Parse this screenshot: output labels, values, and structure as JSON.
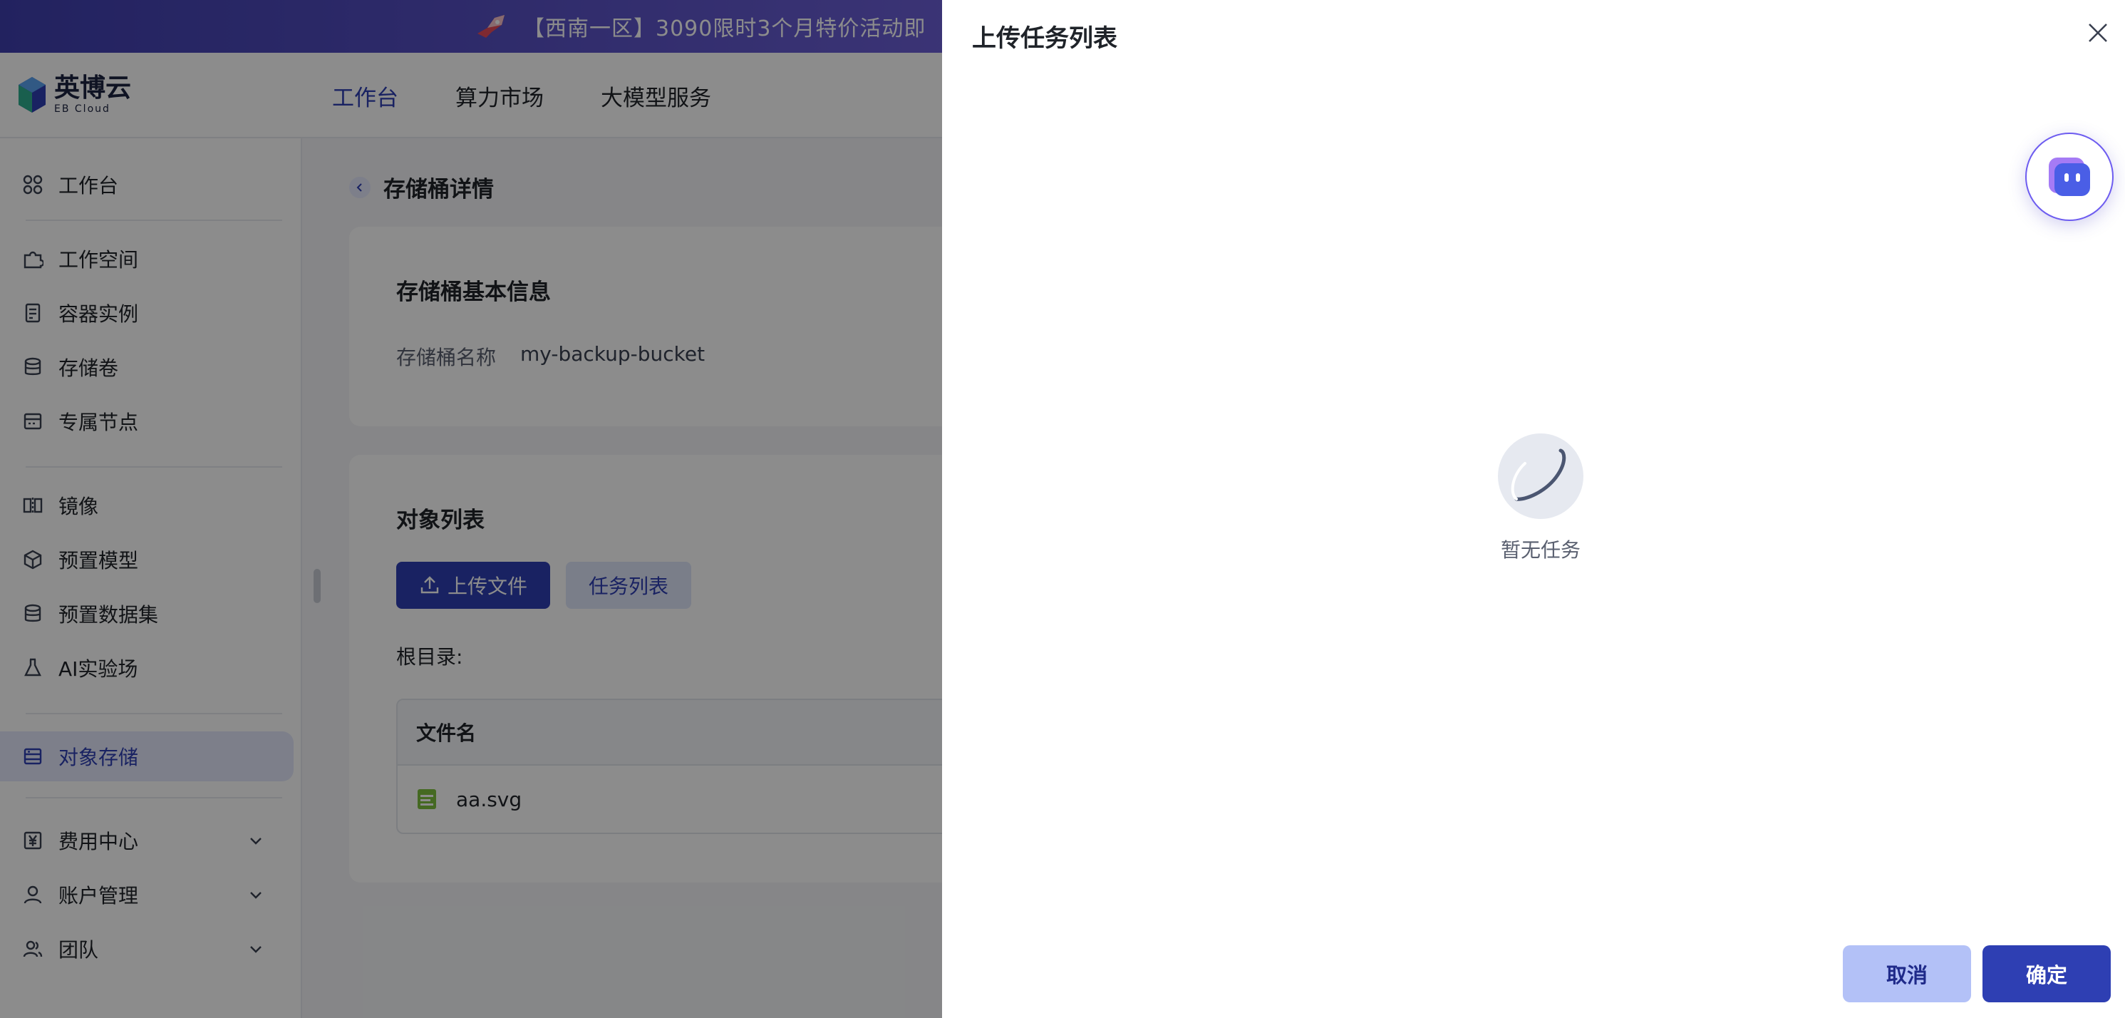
{
  "banner": {
    "text": "【西南一区】3090限时3个月特价活动即"
  },
  "logo": {
    "name_cn": "英博云",
    "name_en": "EB Cloud"
  },
  "topnav": [
    {
      "label": "工作台",
      "active": true
    },
    {
      "label": "算力市场",
      "active": false
    },
    {
      "label": "大模型服务",
      "active": false
    }
  ],
  "sidebar": {
    "items": [
      {
        "label": "工作台",
        "icon": "grid-icon"
      },
      {
        "label": "工作空间",
        "icon": "puzzle-icon"
      },
      {
        "label": "容器实例",
        "icon": "container-icon"
      },
      {
        "label": "存储卷",
        "icon": "database-icon"
      },
      {
        "label": "专属节点",
        "icon": "server-icon"
      },
      {
        "label": "镜像",
        "icon": "mirror-icon"
      },
      {
        "label": "预置模型",
        "icon": "cube-icon"
      },
      {
        "label": "预置数据集",
        "icon": "dataset-icon"
      },
      {
        "label": "AI实验场",
        "icon": "flask-icon"
      },
      {
        "label": "对象存储",
        "icon": "storage-icon",
        "active": true
      },
      {
        "label": "费用中心",
        "icon": "yen-icon"
      },
      {
        "label": "账户管理",
        "icon": "user-icon"
      },
      {
        "label": "团队",
        "icon": "team-icon"
      }
    ]
  },
  "page": {
    "title": "存储桶详情",
    "basic_info": {
      "title": "存储桶基本信息",
      "name_label": "存储桶名称",
      "name_value": "my-backup-bucket"
    },
    "objects": {
      "title": "对象列表",
      "upload_button": "上传文件",
      "tasks_button": "任务列表",
      "root_label": "根目录:",
      "column_filename": "文件名",
      "rows": [
        {
          "filename": "aa.svg"
        }
      ]
    }
  },
  "drawer": {
    "title": "上传任务列表",
    "empty_text": "暂无任务",
    "cancel_label": "取消",
    "confirm_label": "确定"
  },
  "colors": {
    "primary": "#2e3fb3",
    "primary_light": "#e3e8fb",
    "cancel_bg": "#b3c1f7",
    "banner_start": "#3f3fae",
    "banner_end": "#8a7ae8"
  }
}
